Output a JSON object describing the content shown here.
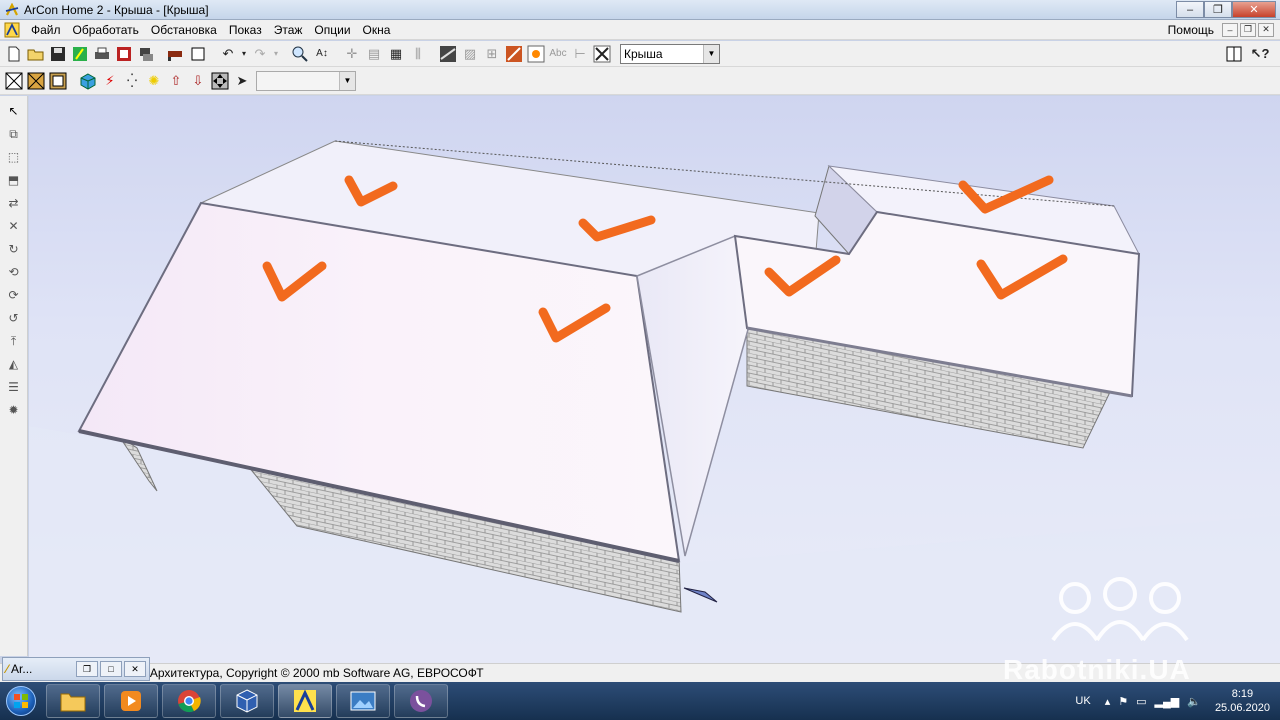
{
  "window": {
    "title": "ArCon  Home 2 - Крыша - [Крыша]",
    "minimize": "–",
    "maximize": "❐",
    "close": "✕"
  },
  "menu": {
    "items": [
      "Файл",
      "Обработать",
      "Обстановка",
      "Показ",
      "Этаж",
      "Опции",
      "Окна"
    ],
    "help": "Помощь",
    "mdi_minimize": "–",
    "mdi_restore": "❐",
    "mdi_close": "✕"
  },
  "toolbar1": {
    "floor_select": "Крыша"
  },
  "toolbar2": {
    "empty_select": ""
  },
  "statusbar": {
    "text": "я Архитектура, Copyright © 2000 mb Software AG, ЕВРОСОФТ"
  },
  "minimized_window": {
    "label": "Ar..."
  },
  "watermark": {
    "text": "Rabotniki.UA"
  },
  "taskbar": {
    "lang": "UK",
    "time": "8:19",
    "date": "25.06.2020"
  },
  "colors": {
    "roof": "#f8f4fb",
    "checkmark": "#f26a1e",
    "brick": "#d8d8d8",
    "sky": "#d6dbf2"
  },
  "icons": {
    "checkmarks": 8
  }
}
